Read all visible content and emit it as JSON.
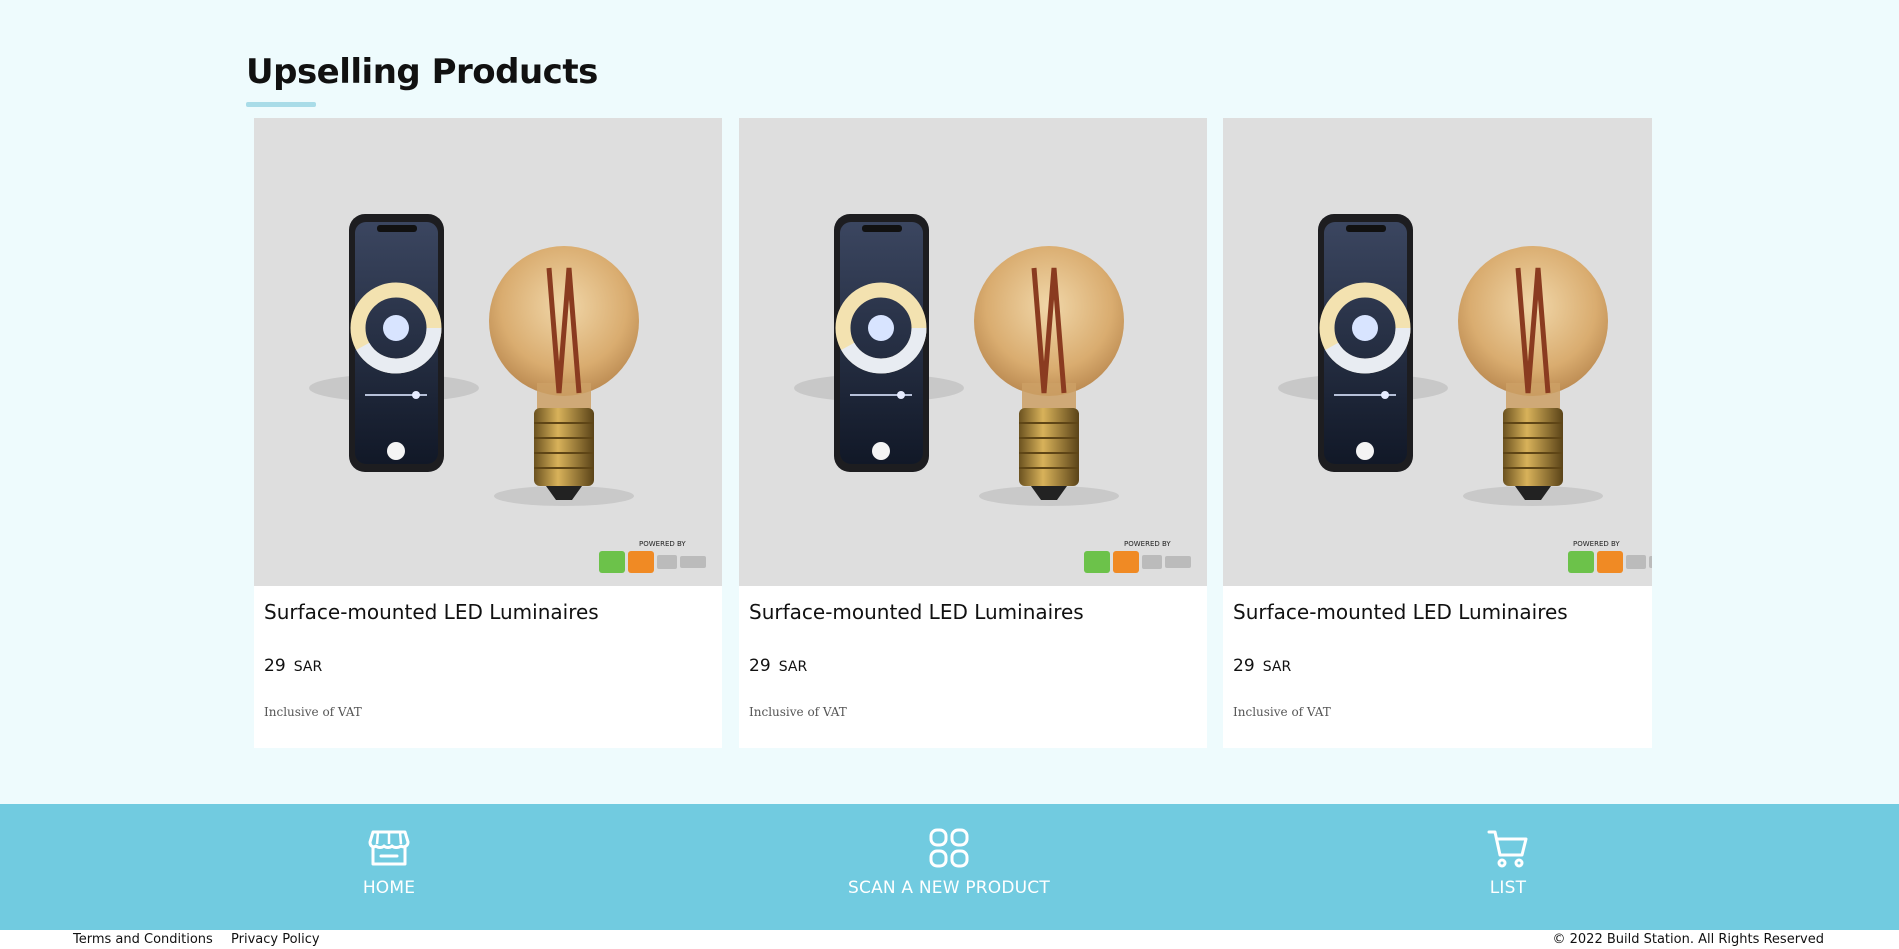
{
  "section": {
    "title": "Upselling Products"
  },
  "products": [
    {
      "name": "Surface-mounted LED Luminaires",
      "price": "29",
      "currency": "SAR",
      "vat_note": "Inclusive of VAT",
      "badge_text": "POWERED BY"
    },
    {
      "name": "Surface-mounted LED Luminaires",
      "price": "29",
      "currency": "SAR",
      "vat_note": "Inclusive of VAT",
      "badge_text": "POWERED BY"
    },
    {
      "name": "Surface-mounted LED Luminaires",
      "price": "29",
      "currency": "SAR",
      "vat_note": "Inclusive of VAT",
      "badge_text": "POWERED BY"
    }
  ],
  "nav": {
    "home": {
      "label": "HOME",
      "icon": "store-icon"
    },
    "scan": {
      "label": "SCAN A NEW PRODUCT",
      "icon": "grid-icon"
    },
    "list": {
      "label": "LIST",
      "icon": "cart-icon"
    }
  },
  "footer": {
    "terms": "Terms and Conditions",
    "privacy": "Privacy Policy",
    "copyright": "© 2022 Build Station. All Rights Reserved"
  },
  "colors": {
    "page_background": "#eefbfd",
    "nav_background": "#71cbe0",
    "accent_underline": "#a9dce8",
    "card_background": "#ffffff"
  }
}
